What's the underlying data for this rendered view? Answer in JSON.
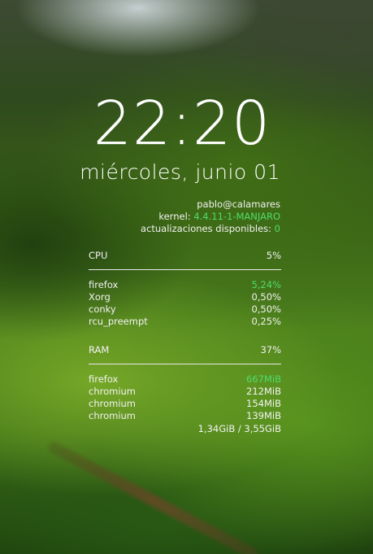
{
  "clock": {
    "time": "22:20",
    "date": "miércoles, junio 01"
  },
  "system": {
    "user_host": "pablo@calamares",
    "kernel_label": "kernel:",
    "kernel_value": "4.4.11-1-MANJARO",
    "updates_label": "actualizaciones disponibles:",
    "updates_value": "0"
  },
  "cpu": {
    "label": "CPU",
    "total": "5%",
    "processes": [
      {
        "name": "firefox",
        "value": "5,24%",
        "highlight": true
      },
      {
        "name": "Xorg",
        "value": "0,50%",
        "highlight": false
      },
      {
        "name": "conky",
        "value": "0,50%",
        "highlight": false
      },
      {
        "name": "rcu_preempt",
        "value": "0,25%",
        "highlight": false
      }
    ]
  },
  "ram": {
    "label": "RAM",
    "total": "37%",
    "processes": [
      {
        "name": "firefox",
        "value": "667MiB",
        "highlight": true
      },
      {
        "name": "chromium",
        "value": "212MiB",
        "highlight": false
      },
      {
        "name": "chromium",
        "value": "154MiB",
        "highlight": false
      },
      {
        "name": "chromium",
        "value": "139MiB",
        "highlight": false
      }
    ],
    "usage": "1,34GiB / 3,55GiB"
  },
  "colors": {
    "accent": "#4fdc6c",
    "text": "#f2f2f2"
  }
}
